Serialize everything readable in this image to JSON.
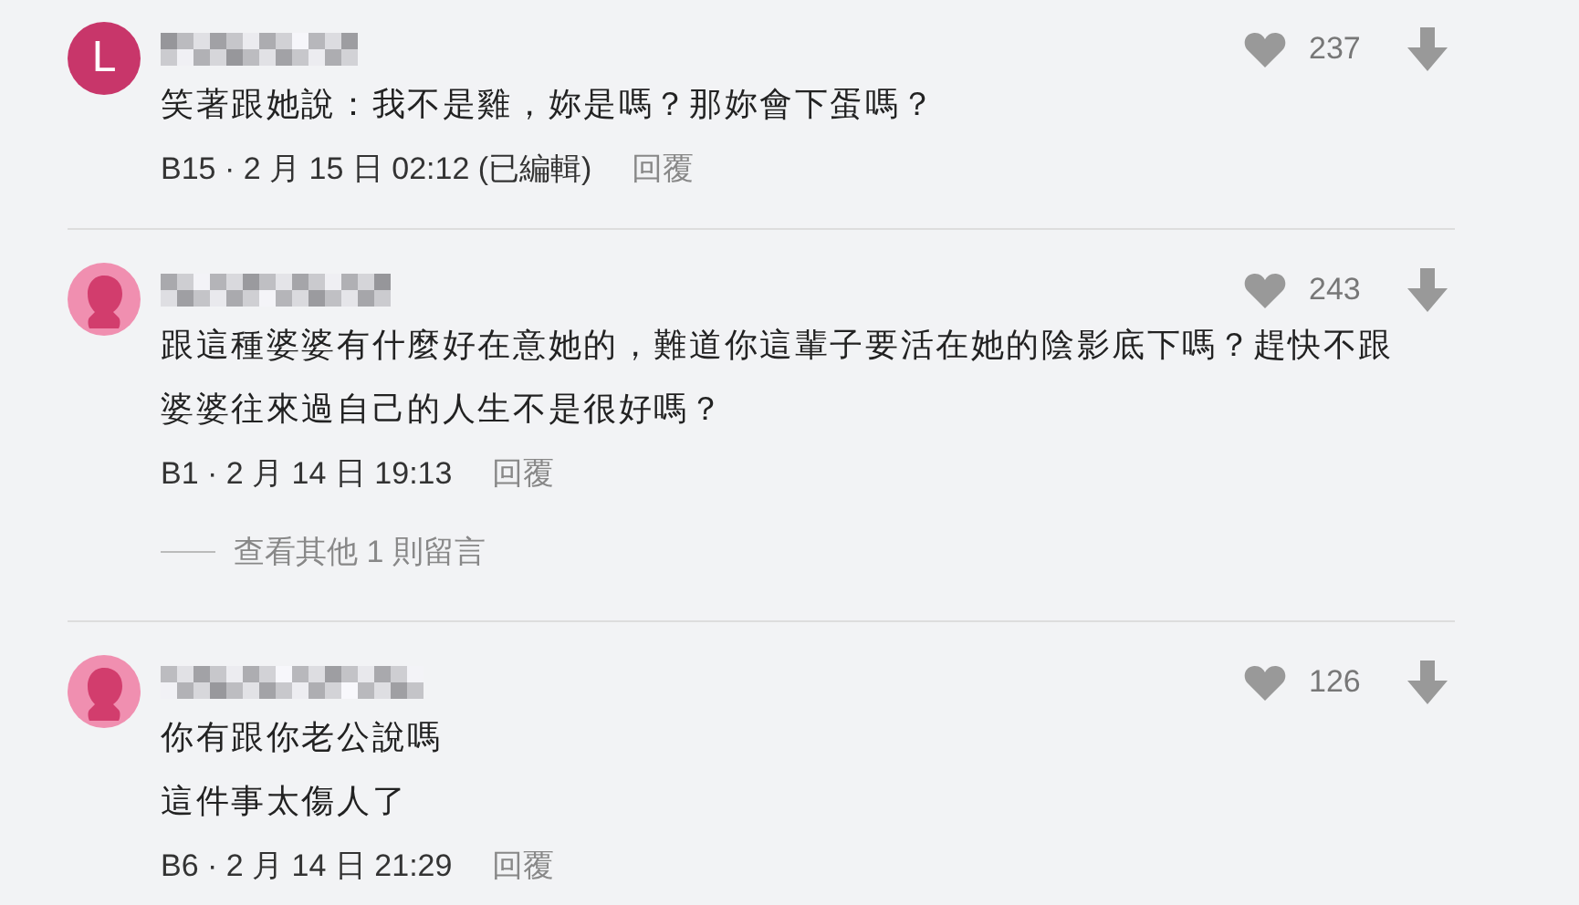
{
  "comments": [
    {
      "avatar": {
        "kind": "letter",
        "letter": "L"
      },
      "likes": "237",
      "lines": [
        "笑著跟她說：我不是雞，妳是嗎？那妳會下蛋嗎？"
      ],
      "meta": "B15 · 2 月 15 日 02:12 (已編輯)",
      "reply": "回覆"
    },
    {
      "avatar": {
        "kind": "silhouette"
      },
      "likes": "243",
      "lines": [
        "跟這種婆婆有什麼好在意她的，難道你這輩子要活在她的陰影底下嗎？趕快不跟",
        "婆婆往來過自己的人生不是很好嗎？"
      ],
      "meta": "B1 · 2 月 14 日 19:13",
      "reply": "回覆",
      "more_replies": "查看其他 1 則留言"
    },
    {
      "avatar": {
        "kind": "silhouette"
      },
      "likes": "126",
      "lines": [
        "你有跟你老公說嗎",
        "這件事太傷人了"
      ],
      "meta": "B6 · 2 月 14 日 21:29",
      "reply": "回覆"
    }
  ]
}
